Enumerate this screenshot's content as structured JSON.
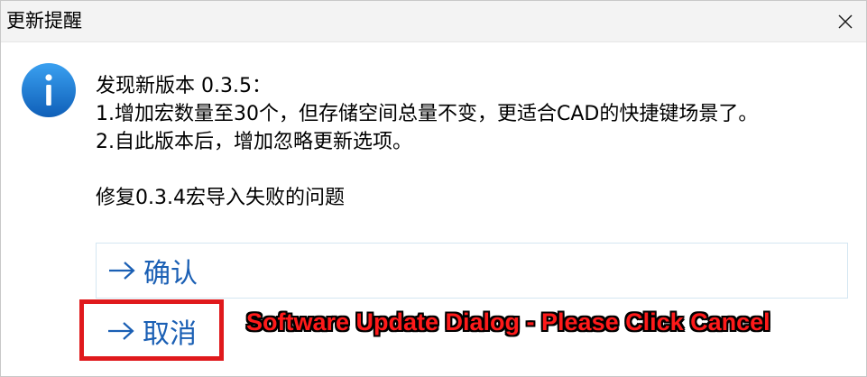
{
  "window": {
    "title": "更新提醒",
    "close_icon": "close-icon"
  },
  "icon": {
    "name": "info-icon",
    "color": "#1e78d0"
  },
  "message": {
    "lines": [
      "发现新版本 0.3.5：",
      "1.增加宏数量至30个，但存储空间总量不变，更适合CAD的快捷键场景了。",
      "2.自此版本后，增加忽略更新选项。",
      "修复0.3.4宏导入失败的问题"
    ]
  },
  "buttons": {
    "confirm": {
      "arrow": "→",
      "label": "确认"
    },
    "cancel": {
      "arrow": "→",
      "label": "取消"
    }
  },
  "annotation": {
    "text": "Software Update Dialog - Please Click Cancel",
    "color": "#ff1a1a"
  }
}
